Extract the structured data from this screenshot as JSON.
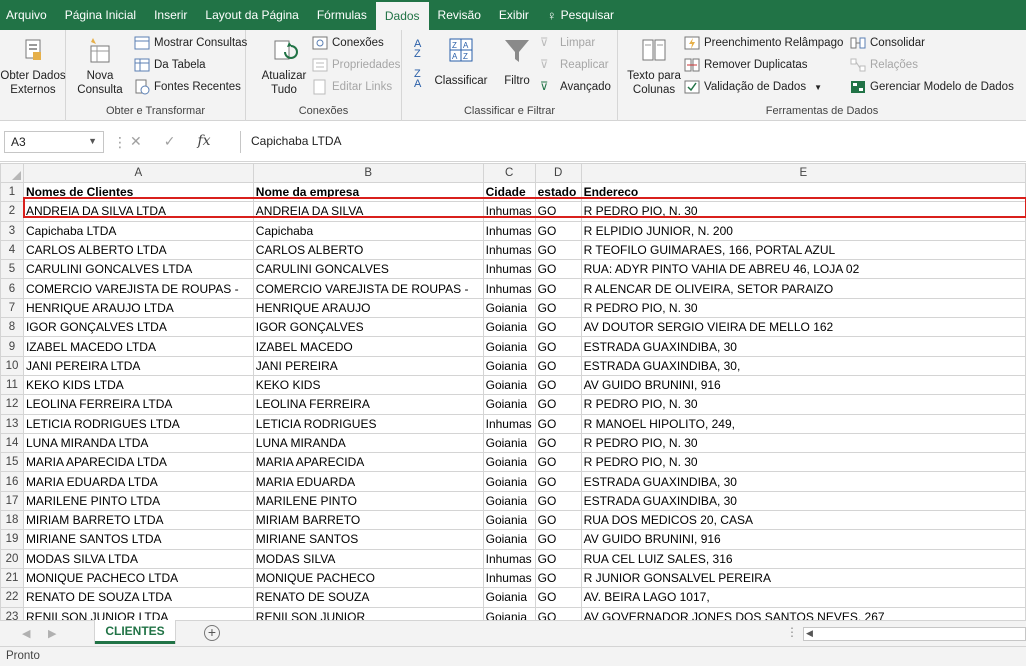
{
  "tabs": [
    "Arquivo",
    "Página Inicial",
    "Inserir",
    "Layout da Página",
    "Fórmulas",
    "Dados",
    "Revisão",
    "Exibir",
    "Pesquisar"
  ],
  "active_tab_index": 5,
  "ribbon": {
    "obter_externos": "Obter Dados\nExternos",
    "nova_consulta": "Nova\nConsulta",
    "mostrar_consultas": "Mostrar Consultas",
    "da_tabela": "Da Tabela",
    "fontes_recentes": "Fontes Recentes",
    "group_obter": "Obter e Transformar",
    "atualizar_tudo": "Atualizar\nTudo",
    "conexoes": "Conexões",
    "propriedades": "Propriedades",
    "editar_links": "Editar Links",
    "group_conexoes": "Conexões",
    "classificar": "Classificar",
    "filtro": "Filtro",
    "limpar": "Limpar",
    "reaplicar": "Reaplicar",
    "avancado": "Avançado",
    "group_classificar": "Classificar e Filtrar",
    "texto_para_colunas": "Texto para\nColunas",
    "preenchimento": "Preenchimento Relâmpago",
    "remover_duplicatas": "Remover Duplicatas",
    "validacao": "Validação de Dados",
    "consolidar": "Consolidar",
    "relacoes": "Relações",
    "gerenciar_modelo": "Gerenciar Modelo de Dados",
    "group_ferramentas": "Ferramentas de Dados"
  },
  "formula_bar": {
    "name_box": "A3",
    "fx": "fx",
    "content": "Capichaba LTDA"
  },
  "columns": [
    "A",
    "B",
    "C",
    "D",
    "E"
  ],
  "rows": [
    [
      "Nomes de Clientes",
      "Nome da empresa",
      "Cidade",
      "estado",
      "Endereco"
    ],
    [
      "ANDREIA DA SILVA  LTDA",
      "ANDREIA DA SILVA",
      "Inhumas",
      "GO",
      "R PEDRO PIO, N. 30"
    ],
    [
      "Capichaba LTDA",
      "Capichaba",
      "Inhumas",
      "GO",
      "R ELPIDIO JUNIOR, N. 200"
    ],
    [
      "CARLOS ALBERTO  LTDA",
      "CARLOS ALBERTO",
      "Inhumas",
      "GO",
      "R TEOFILO GUIMARAES, 166, PORTAL AZUL"
    ],
    [
      "CARULINI GONCALVES  LTDA",
      "CARULINI GONCALVES",
      "Inhumas",
      "GO",
      "RUA: ADYR PINTO VAHIA DE ABREU 46,  LOJA 02"
    ],
    [
      "COMERCIO VAREJISTA DE ROUPAS -",
      "COMERCIO VAREJISTA DE ROUPAS -",
      "Inhumas",
      "GO",
      "R ALENCAR DE OLIVEIRA, SETOR PARAIZO"
    ],
    [
      "HENRIQUE ARAUJO  LTDA",
      "HENRIQUE ARAUJO",
      "Goiania",
      "GO",
      "R PEDRO PIO, N. 30"
    ],
    [
      "IGOR GONÇALVES  LTDA",
      "IGOR GONÇALVES",
      "Goiania",
      "GO",
      "AV DOUTOR SERGIO VIEIRA DE MELLO 162"
    ],
    [
      "IZABEL MACEDO  LTDA",
      "IZABEL MACEDO",
      "Goiania",
      "GO",
      "ESTRADA GUAXINDIBA, 30"
    ],
    [
      "JANI PEREIRA  LTDA",
      "JANI PEREIRA",
      "Goiania",
      "GO",
      "ESTRADA GUAXINDIBA, 30,"
    ],
    [
      "KEKO KIDS  LTDA",
      "KEKO KIDS",
      "Goiania",
      "GO",
      "AV GUIDO BRUNINI, 916"
    ],
    [
      "LEOLINA FERREIRA  LTDA",
      "LEOLINA FERREIRA",
      "Goiania",
      "GO",
      "R PEDRO PIO, N. 30"
    ],
    [
      "LETICIA RODRIGUES  LTDA",
      "LETICIA RODRIGUES",
      "Inhumas",
      "GO",
      "R MANOEL HIPOLITO, 249,"
    ],
    [
      "LUNA MIRANDA  LTDA",
      "LUNA MIRANDA",
      "Goiania",
      "GO",
      "R PEDRO PIO, N. 30"
    ],
    [
      "MARIA APARECIDA  LTDA",
      "MARIA APARECIDA",
      "Goiania",
      "GO",
      "R PEDRO PIO, N. 30"
    ],
    [
      "MARIA EDUARDA  LTDA",
      "MARIA EDUARDA",
      "Goiania",
      "GO",
      "ESTRADA GUAXINDIBA, 30"
    ],
    [
      "MARILENE PINTO  LTDA",
      "MARILENE PINTO",
      "Goiania",
      "GO",
      "ESTRADA GUAXINDIBA, 30"
    ],
    [
      "MIRIAM BARRETO  LTDA",
      "MIRIAM BARRETO",
      "Goiania",
      "GO",
      "RUA DOS MEDICOS 20,  CASA"
    ],
    [
      "MIRIANE SANTOS  LTDA",
      "MIRIANE SANTOS",
      "Goiania",
      "GO",
      "AV GUIDO BRUNINI, 916"
    ],
    [
      "MODAS SILVA  LTDA",
      "MODAS SILVA",
      "Inhumas",
      "GO",
      "RUA CEL LUIZ SALES, 316"
    ],
    [
      "MONIQUE PACHECO  LTDA",
      "MONIQUE PACHECO",
      "Inhumas",
      "GO",
      "R JUNIOR GONSALVEL PEREIRA"
    ],
    [
      "RENATO DE SOUZA  LTDA",
      "RENATO DE SOUZA",
      "Goiania",
      "GO",
      "AV. BEIRA LAGO 1017,"
    ],
    [
      "RENILSON JUNIOR  LTDA",
      "RENILSON JUNIOR",
      "Goiania",
      "GO",
      "AV GOVERNADOR JONES DOS SANTOS NEVES, 267"
    ]
  ],
  "sheet_tab": "CLIENTES",
  "add_sheet": "+",
  "status": "Pronto",
  "colors": {
    "accent": "#217346",
    "highlight": "#d9201c"
  }
}
